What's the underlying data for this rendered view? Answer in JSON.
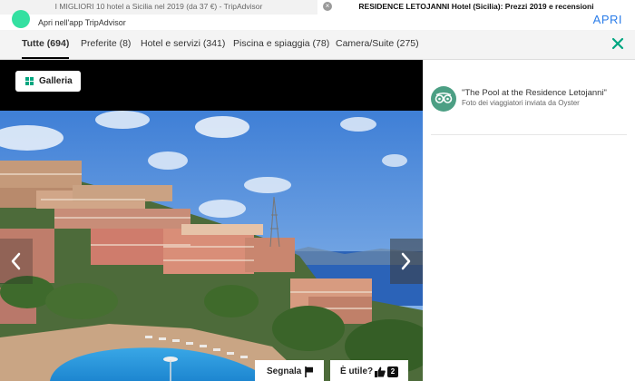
{
  "browser_tabs": [
    {
      "title": "I MIGLIORI 10 hotel a Sicilia nel 2019 (da 37 €) - TripAdvisor"
    },
    {
      "title": "RESIDENCE LETOJANNI Hotel (Sicilia): Prezzi 2019 e recensioni"
    }
  ],
  "banner": {
    "text": "Apri nell'app TripAdvisor",
    "open_label": "APRI"
  },
  "filters": [
    {
      "label": "Tutte (694)"
    },
    {
      "label": "Preferite (8)"
    },
    {
      "label": "Hotel e servizi (341)"
    },
    {
      "label": "Piscina e spiaggia (78)"
    },
    {
      "label": "Camera/Suite (275)"
    }
  ],
  "viewer": {
    "gallery_label": "Galleria",
    "report_label": "Segnala",
    "useful_label": "È utile?",
    "useful_count": "2"
  },
  "photo_info": {
    "title": "\"The Pool at the Residence Letojanni\"",
    "subtitle": "Foto dei viaggiatori inviata da Oyster"
  },
  "icons": {
    "gallery": "grid-icon",
    "close": "close-icon",
    "prev": "chevron-left-icon",
    "next": "chevron-right-icon",
    "report": "flag-icon",
    "useful": "thumbs-up-icon"
  },
  "colors": {
    "accent": "#00a680",
    "brand": "#34e0a1",
    "link": "#2b7de9"
  }
}
